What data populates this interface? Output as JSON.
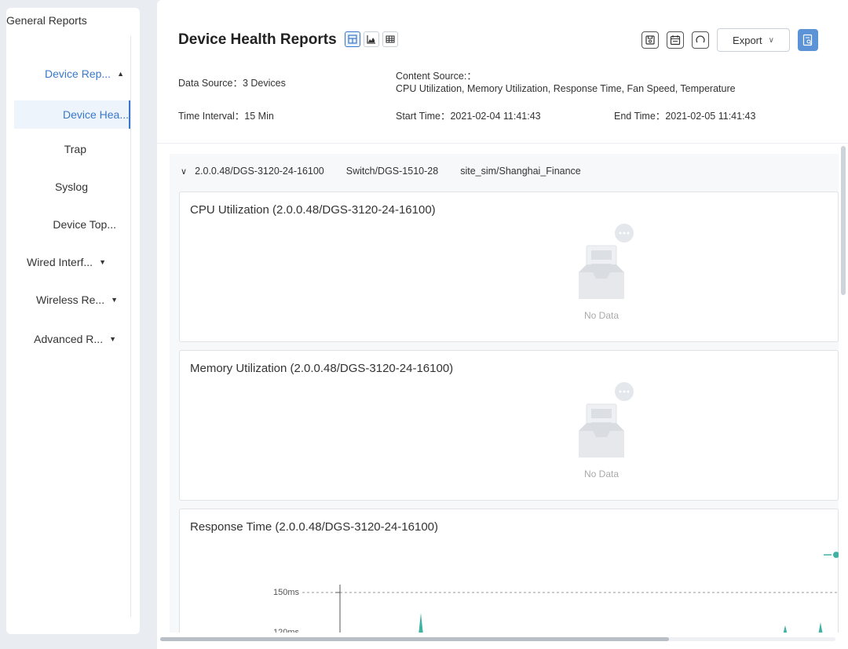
{
  "sidebar": {
    "title": "General Reports",
    "items": [
      {
        "label": "Device Rep...",
        "chevron": "up"
      },
      {
        "label": "Device Hea..."
      },
      {
        "label": "Trap"
      },
      {
        "label": "Syslog"
      },
      {
        "label": "Device Top..."
      },
      {
        "label": "Wired Interf...",
        "chevron": "down"
      },
      {
        "label": "Wireless Re...",
        "chevron": "down"
      },
      {
        "label": "Advanced R...",
        "chevron": "down"
      }
    ]
  },
  "header": {
    "title": "Device Health Reports",
    "export_label": "Export",
    "data_source_label": "Data Source：",
    "data_source_value": "3 Devices",
    "content_source_label": "Content Source:：",
    "content_source_value": "CPU Utilization, Memory Utilization, Response Time, Fan Speed, Temperature",
    "time_interval_label": "Time Interval：",
    "time_interval_value": "15 Min",
    "start_time_label": "Start Time：",
    "start_time_value": "2021-02-04 11:41:43",
    "end_time_label": "End Time：",
    "end_time_value": "2021-02-05 11:41:43"
  },
  "device_group": {
    "device": "2.0.0.48/DGS-3120-24-16100",
    "switch": "Switch/DGS-1510-28",
    "site": "site_sim/Shanghai_Finance"
  },
  "cards": {
    "cpu_title": "CPU Utilization (2.0.0.48/DGS-3120-24-16100)",
    "memory_title": "Memory Utilization (2.0.0.48/DGS-3120-24-16100)",
    "response_title": "Response Time (2.0.0.48/DGS-3120-24-16100)",
    "no_data": "No Data"
  },
  "chart_data": {
    "type": "line",
    "title": "Response Time (2.0.0.48/DGS-3120-24-16100)",
    "y_ticks": [
      "150ms",
      "120ms"
    ],
    "threshold_line": 150
  },
  "colors": {
    "accent": "#3a78c9",
    "primary_button": "#5b93d6",
    "chart_line": "#3fb2a4"
  }
}
